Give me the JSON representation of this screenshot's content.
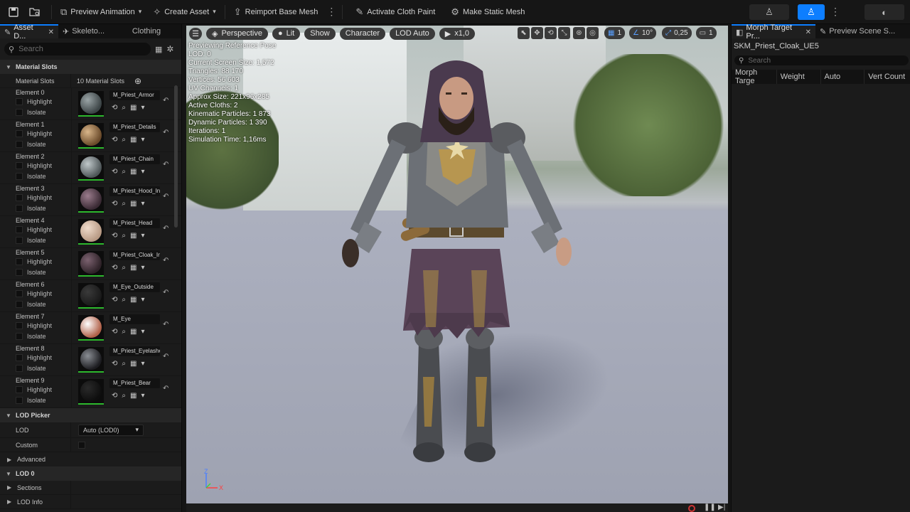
{
  "toolbar": {
    "preview_animation": "Preview Animation",
    "create_asset": "Create Asset",
    "reimport": "Reimport Base Mesh",
    "activate_cloth": "Activate Cloth Paint",
    "make_static": "Make Static Mesh"
  },
  "left_tabs": [
    {
      "label": "Asset D..."
    },
    {
      "label": "Skeleto..."
    },
    {
      "label": "Clothing"
    }
  ],
  "search_placeholder": "Search",
  "material_slots": {
    "header": "Material Slots",
    "label": "Material Slots",
    "count": "10 Material Slots",
    "highlight": "Highlight",
    "isolate": "Isolate",
    "elements": [
      {
        "name": "Element 0",
        "material": "M_Priest_Armor"
      },
      {
        "name": "Element 1",
        "material": "M_Priest_Details"
      },
      {
        "name": "Element 2",
        "material": "M_Priest_Chain"
      },
      {
        "name": "Element 3",
        "material": "M_Priest_Hood_Ins"
      },
      {
        "name": "Element 4",
        "material": "M_Priest_Head"
      },
      {
        "name": "Element 5",
        "material": "M_Priest_Cloak_In"
      },
      {
        "name": "Element 6",
        "material": "M_Eye_Outside"
      },
      {
        "name": "Element 7",
        "material": "M_Eye"
      },
      {
        "name": "Element 8",
        "material": "M_Priest_Eyelashe"
      },
      {
        "name": "Element 9",
        "material": "M_Priest_Bear"
      }
    ]
  },
  "lod_picker": {
    "header": "LOD Picker",
    "lod_label": "LOD",
    "lod_value": "Auto (LOD0)",
    "custom_label": "Custom",
    "advanced": "Advanced"
  },
  "lod0": {
    "header": "LOD 0",
    "sections": "Sections",
    "lod_info": "LOD Info"
  },
  "viewport": {
    "perspective": "Perspective",
    "lit": "Lit",
    "show": "Show",
    "character": "Character",
    "lod_auto": "LOD Auto",
    "play_speed": "x1,0",
    "grid_value": "1",
    "angle_value": "10°",
    "scale_value": "0,25",
    "camera_value": "1",
    "stats": [
      "Previewing Reference Pose",
      "LOD: 0",
      "Current Screen Size: 1,572",
      "Triangles: 88 170",
      "Vertices: 56 603",
      "UV Channels: 1",
      "Approx Size: 221x96x285",
      "Active Cloths: 2",
      "Kinematic Particles: 1 873",
      "Dynamic Particles: 1 390",
      "Iterations: 1",
      "Simulation Time: 1,16ms"
    ]
  },
  "right_panel": {
    "tabs": [
      {
        "label": "Morph Target Pr..."
      },
      {
        "label": "Preview Scene S..."
      }
    ],
    "asset_name": "SKM_Priest_Cloak_UE5",
    "search_placeholder": "Search",
    "columns": [
      "Morph Targe",
      "Weight",
      "Auto",
      "Vert Count"
    ]
  },
  "colors": {
    "accent": "#0d7eff",
    "active_button": "#1b5fb4",
    "thumb_ok": "#2db82d"
  }
}
